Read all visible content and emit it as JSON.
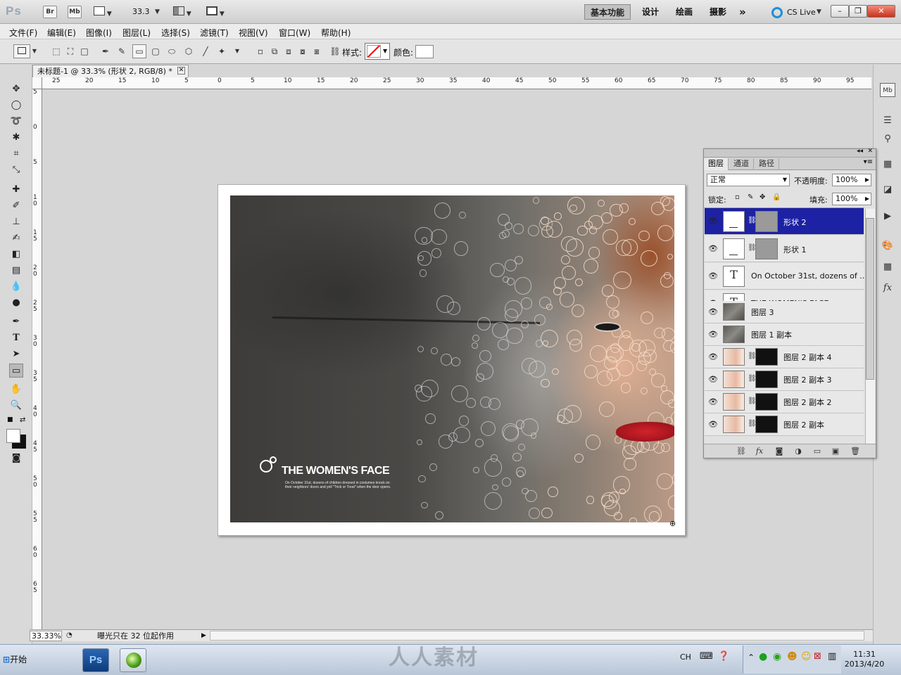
{
  "app": {
    "logo": "Ps",
    "bridge_button": "Br",
    "minibridge_button": "Mb",
    "zoom_value": "33.3",
    "workspaces": [
      "基本功能",
      "设计",
      "绘画",
      "摄影"
    ],
    "more_workspaces": "»",
    "cs_live": "CS Live",
    "window_controls": [
      "minimize",
      "restore",
      "close"
    ]
  },
  "menu": [
    "文件(F)",
    "编辑(E)",
    "图像(I)",
    "图层(L)",
    "选择(S)",
    "滤镜(T)",
    "视图(V)",
    "窗口(W)",
    "帮助(H)"
  ],
  "options": {
    "style_label": "样式:",
    "color_label": "颜色:"
  },
  "document": {
    "tab_title": "未标题-1 @ 33.3% (形状 2, RGB/8) *",
    "ruler_h": [
      "25",
      "20",
      "15",
      "10",
      "5",
      "0",
      "5",
      "10",
      "15",
      "20",
      "25",
      "30",
      "35",
      "40",
      "45",
      "50",
      "55",
      "60",
      "65",
      "70",
      "75",
      "80",
      "85",
      "90",
      "95"
    ],
    "ruler_v": [
      "5",
      "0",
      "5",
      "1\n0",
      "1\n5",
      "2\n0",
      "2\n5",
      "3\n0",
      "3\n5",
      "4\n0",
      "4\n5",
      "5\n0",
      "5\n5",
      "6\n0",
      "6\n5"
    ]
  },
  "artwork": {
    "title": "THE WOMEN'S FACE",
    "body": "On October 31st, dozens of children dressed in costumes knock on their neighbors' doors and yell \"Trick or Treat\" when the door opens."
  },
  "status": {
    "zoom": "33.33%",
    "message": "曝光只在 32 位起作用"
  },
  "layers_panel": {
    "tabs": [
      "图层",
      "通道",
      "路径"
    ],
    "blend_mode": "正常",
    "opacity_label": "不透明度:",
    "opacity_value": "100%",
    "lock_label": "锁定:",
    "fill_label": "填充:",
    "fill_value": "100%",
    "layers": [
      {
        "name": "形状 2",
        "thumb": "shape",
        "mask": "gray",
        "selected": true
      },
      {
        "name": "形状 1",
        "thumb": "shape",
        "mask": "gray",
        "selected": false
      },
      {
        "name": "On October 31st, dozens of ...",
        "thumb": "text",
        "mask": "",
        "selected": false
      },
      {
        "name": "THE WOMEN'S FACE",
        "thumb": "text",
        "mask": "",
        "selected": false
      },
      {
        "name": "图层 3",
        "thumb": "img",
        "mask": "",
        "selected": false
      },
      {
        "name": "图层 1 副本",
        "thumb": "img",
        "mask": "",
        "selected": false
      },
      {
        "name": "图层 2 副本 4",
        "thumb": "face",
        "mask": "dark",
        "selected": false
      },
      {
        "name": "图层 2 副本 3",
        "thumb": "face",
        "mask": "dark",
        "selected": false
      },
      {
        "name": "图层 2 副本 2",
        "thumb": "face",
        "mask": "dark",
        "selected": false
      },
      {
        "name": "图层 2 副本",
        "thumb": "face",
        "mask": "dark",
        "selected": false
      }
    ]
  },
  "taskbar": {
    "start_label": "开始",
    "ps_label": "Ps",
    "watermark": "人人素材",
    "lang": "CH",
    "time": "11:31",
    "date": "2013/4/20"
  }
}
